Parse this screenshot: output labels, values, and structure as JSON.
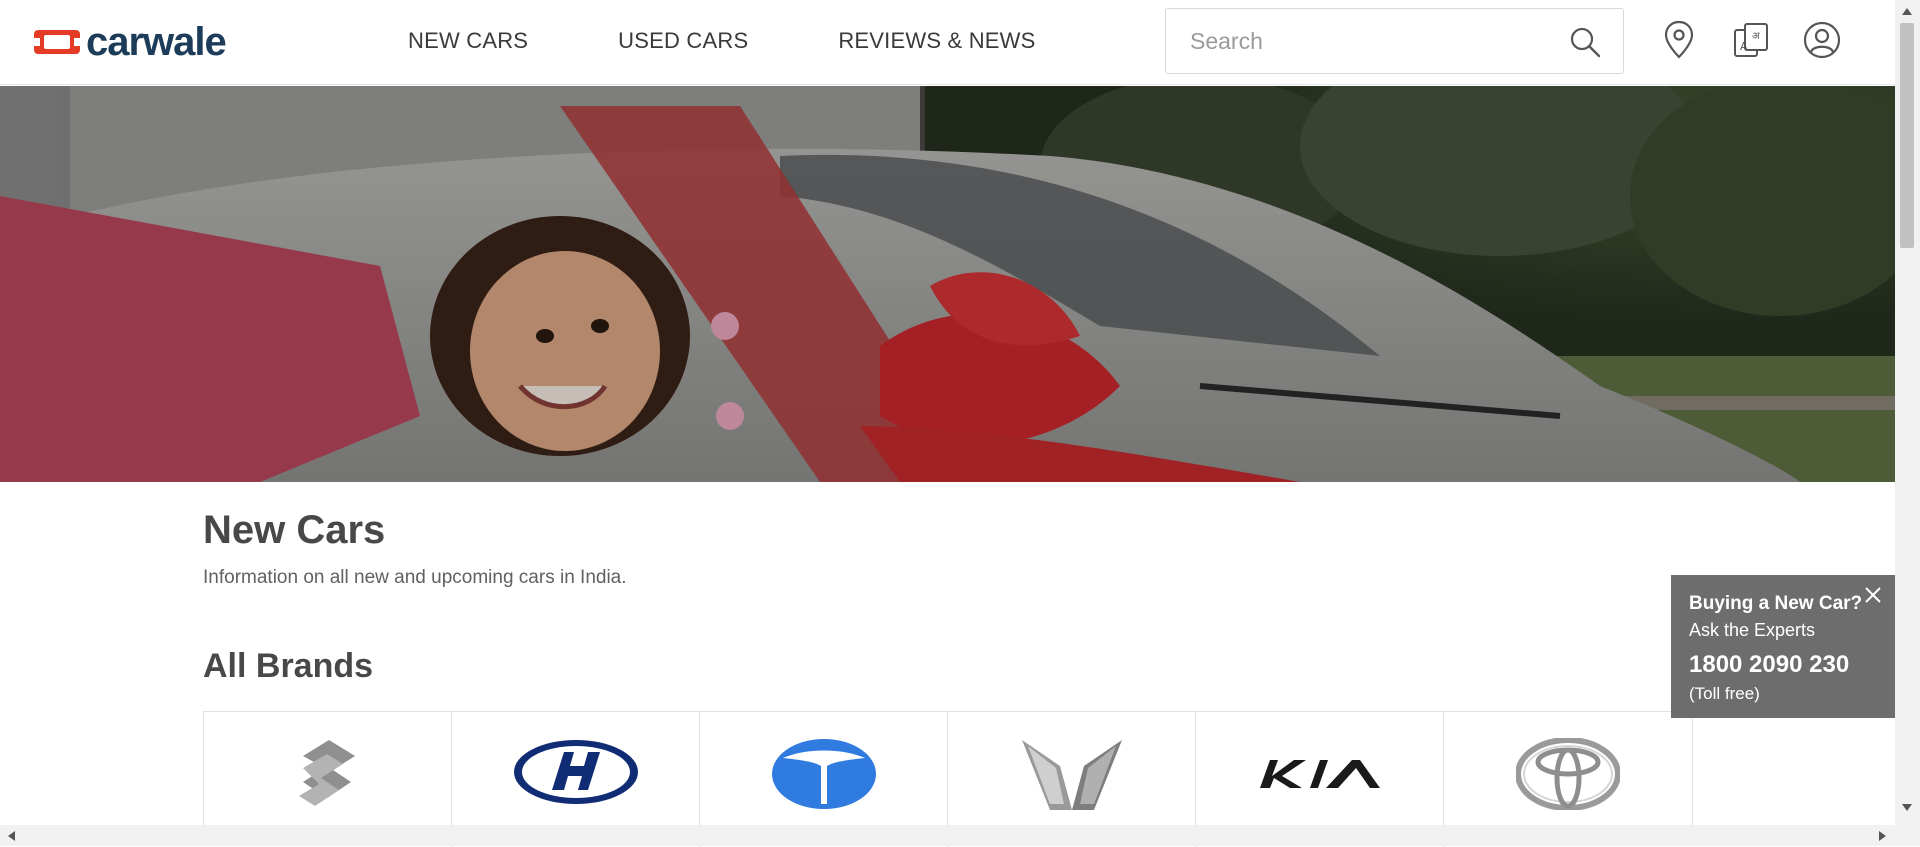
{
  "header": {
    "logo_text": "carwale",
    "nav": [
      {
        "label": "NEW CARS"
      },
      {
        "label": "USED CARS"
      },
      {
        "label": "REVIEWS & NEWS"
      }
    ],
    "search_placeholder": "Search",
    "icons": [
      "location-pin-icon",
      "language-icon",
      "user-account-icon"
    ]
  },
  "hero": {
    "alt": ""
  },
  "main": {
    "title": "New Cars",
    "description": "Information on all new and upcoming cars in India.",
    "brands_heading": "All Brands",
    "brands": [
      {
        "name": "Maruti Suzuki",
        "icon": "suzuki-logo-icon"
      },
      {
        "name": "Hyundai",
        "icon": "hyundai-logo-icon"
      },
      {
        "name": "Tata",
        "icon": "tata-logo-icon"
      },
      {
        "name": "Mahindra",
        "icon": "mahindra-logo-icon"
      },
      {
        "name": "Kia",
        "icon": "kia-logo-icon"
      },
      {
        "name": "Toyota",
        "icon": "toyota-logo-icon"
      }
    ]
  },
  "expert_card": {
    "title": "Buying a New Car?",
    "subtitle": "Ask the Experts",
    "phone": "1800 2090 230",
    "note": "(Toll free)"
  },
  "colors": {
    "brand_red": "#e43b26",
    "brand_navy": "#1c3c5a",
    "card_bg": "#6d6d6d"
  }
}
